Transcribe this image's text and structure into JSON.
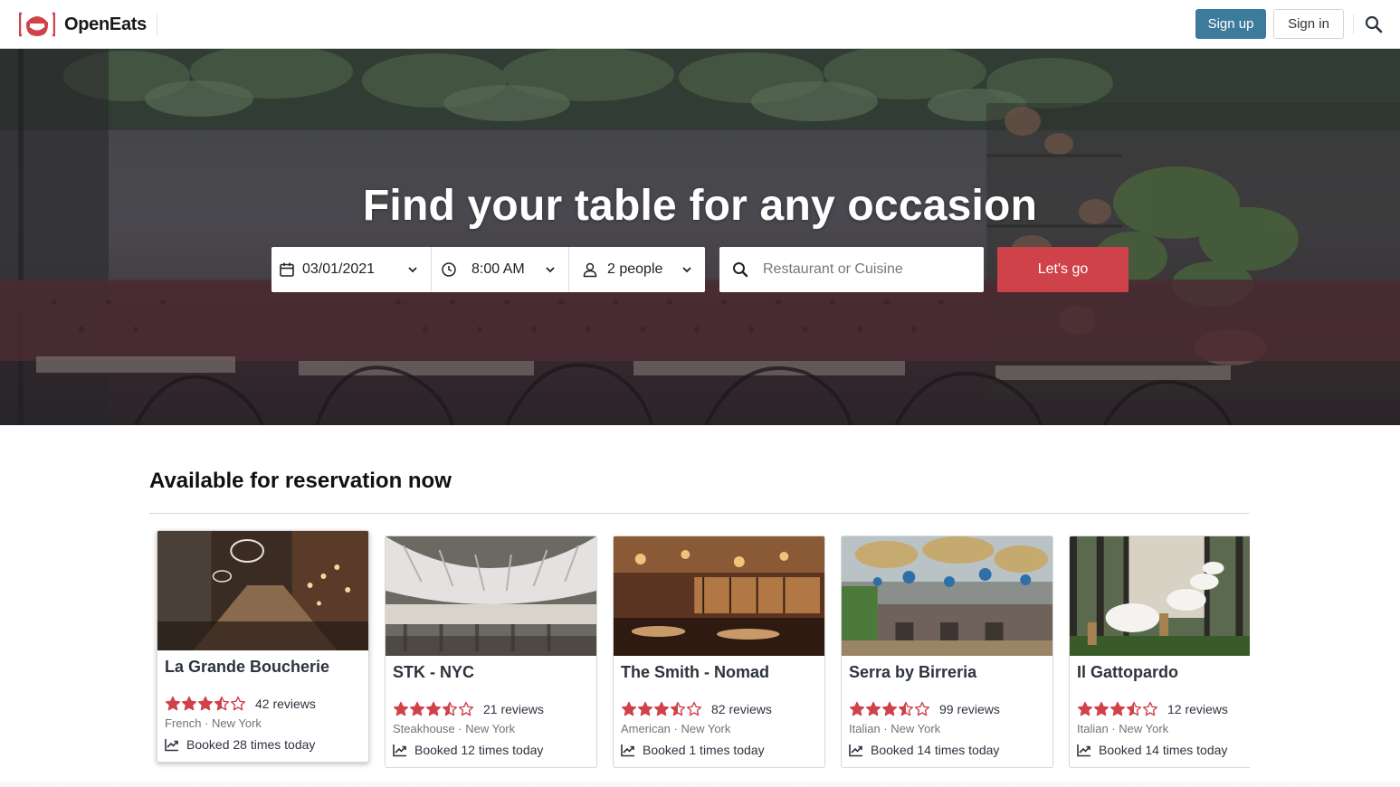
{
  "brand": {
    "name": "OpenEats",
    "accent": "#d0424a",
    "primary": "#3d7b9c"
  },
  "header": {
    "signup_label": "Sign up",
    "signin_label": "Sign in",
    "search_icon": "search-icon"
  },
  "hero": {
    "title": "Find your table for any occasion",
    "date": "03/01/2021",
    "time": "8:00 AM",
    "party": "2 people",
    "search_placeholder": "Restaurant or Cuisine",
    "go_label": "Let's go"
  },
  "section": {
    "title": "Available for reservation now"
  },
  "restaurants": [
    {
      "name": "La Grande Boucherie",
      "rating": 3.5,
      "reviews": "42 reviews",
      "meta": "French · New York",
      "booked": "Booked 28 times today"
    },
    {
      "name": "STK - NYC",
      "rating": 3.5,
      "reviews": "21 reviews",
      "meta": "Steakhouse · New York",
      "booked": "Booked 12 times today"
    },
    {
      "name": "The Smith - Nomad",
      "rating": 3.5,
      "reviews": "82 reviews",
      "meta": "American · New York",
      "booked": "Booked 1 times today"
    },
    {
      "name": "Serra by Birreria",
      "rating": 3.5,
      "reviews": "99 reviews",
      "meta": "Italian · New York",
      "booked": "Booked 14 times today"
    },
    {
      "name": "Il Gattopardo",
      "rating": 3.5,
      "reviews": "12 reviews",
      "meta": "Italian · New York",
      "booked": "Booked 14 times today"
    }
  ]
}
